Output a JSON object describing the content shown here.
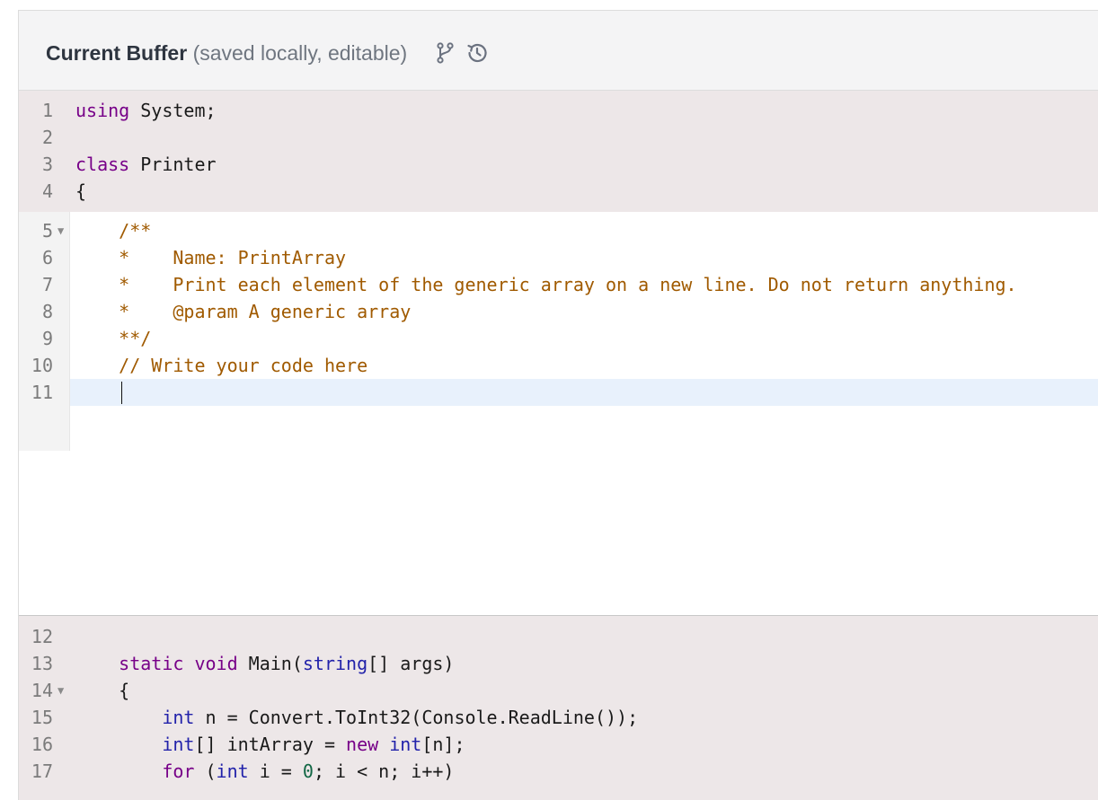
{
  "header": {
    "title_bold": "Current Buffer",
    "title_sub": "(saved locally, editable)",
    "icons": [
      "branch-icon",
      "history-icon"
    ]
  },
  "code": {
    "top": [
      {
        "n": "1",
        "tokens": [
          {
            "t": "using",
            "c": "kw"
          },
          {
            "t": " System;",
            "c": ""
          }
        ]
      },
      {
        "n": "2",
        "tokens": []
      },
      {
        "n": "3",
        "tokens": [
          {
            "t": "class",
            "c": "kw"
          },
          {
            "t": " Printer",
            "c": ""
          }
        ]
      },
      {
        "n": "4",
        "tokens": [
          {
            "t": "{",
            "c": ""
          }
        ]
      }
    ],
    "editable": [
      {
        "n": "5",
        "fold": true,
        "tokens": [
          {
            "t": "    /**",
            "c": "cm"
          }
        ]
      },
      {
        "n": "6",
        "tokens": [
          {
            "t": "    *    Name: PrintArray",
            "c": "cm"
          }
        ]
      },
      {
        "n": "7",
        "tokens": [
          {
            "t": "    *    Print each element of the generic array on a new line. Do not return anything.",
            "c": "cm"
          }
        ]
      },
      {
        "n": "8",
        "tokens": [
          {
            "t": "    *    @param A generic array",
            "c": "cm"
          }
        ]
      },
      {
        "n": "9",
        "tokens": [
          {
            "t": "    **/",
            "c": "cm"
          }
        ]
      },
      {
        "n": "10",
        "tokens": [
          {
            "t": "    // Write your code here",
            "c": "cm"
          }
        ]
      },
      {
        "n": "11",
        "tokens": []
      }
    ],
    "bottom": [
      {
        "n": "12",
        "tokens": []
      },
      {
        "n": "13",
        "tokens": [
          {
            "t": "    ",
            "c": ""
          },
          {
            "t": "static",
            "c": "kw"
          },
          {
            "t": " ",
            "c": ""
          },
          {
            "t": "void",
            "c": "kw"
          },
          {
            "t": " Main(",
            "c": ""
          },
          {
            "t": "string",
            "c": "ty"
          },
          {
            "t": "[] args)",
            "c": ""
          }
        ]
      },
      {
        "n": "14",
        "fold": true,
        "tokens": [
          {
            "t": "    {",
            "c": ""
          }
        ]
      },
      {
        "n": "15",
        "tokens": [
          {
            "t": "        ",
            "c": ""
          },
          {
            "t": "int",
            "c": "ty"
          },
          {
            "t": " n = Convert.ToInt32(Console.ReadLine());",
            "c": ""
          }
        ]
      },
      {
        "n": "16",
        "tokens": [
          {
            "t": "        ",
            "c": ""
          },
          {
            "t": "int",
            "c": "ty"
          },
          {
            "t": "[] intArray = ",
            "c": ""
          },
          {
            "t": "new",
            "c": "kw"
          },
          {
            "t": " ",
            "c": ""
          },
          {
            "t": "int",
            "c": "ty"
          },
          {
            "t": "[n];",
            "c": ""
          }
        ]
      },
      {
        "n": "17",
        "tokens": [
          {
            "t": "        ",
            "c": ""
          },
          {
            "t": "for",
            "c": "kw"
          },
          {
            "t": " (",
            "c": ""
          },
          {
            "t": "int",
            "c": "ty"
          },
          {
            "t": " i = ",
            "c": ""
          },
          {
            "t": "0",
            "c": "num"
          },
          {
            "t": "; i < n; i++)",
            "c": ""
          }
        ]
      }
    ]
  }
}
